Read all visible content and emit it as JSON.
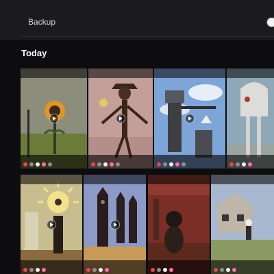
{
  "backup": {
    "label": "Backup",
    "toggle_on": false
  },
  "section": {
    "title": "Today"
  },
  "colors": {
    "background": "#0d0d0f",
    "row_background": "#1b1b1d",
    "toggle_track": "#3a3a3c"
  },
  "thumbnails": [
    {
      "name": "thumbnail-flower-creature",
      "icon": "play-icon"
    },
    {
      "name": "thumbnail-scarecrow-figure",
      "icon": "play-icon"
    },
    {
      "name": "thumbnail-water-tower",
      "icon": "play-icon"
    },
    {
      "name": "thumbnail-skeleton-monster",
      "icon": "play-icon"
    },
    {
      "name": "thumbnail-sun-eye-figure",
      "icon": "play-icon"
    },
    {
      "name": "thumbnail-hooded-figures",
      "icon": "play-icon"
    },
    {
      "name": "thumbnail-red-room-figure",
      "icon": "play-icon"
    },
    {
      "name": "thumbnail-house-figure",
      "icon": "play-icon"
    }
  ]
}
